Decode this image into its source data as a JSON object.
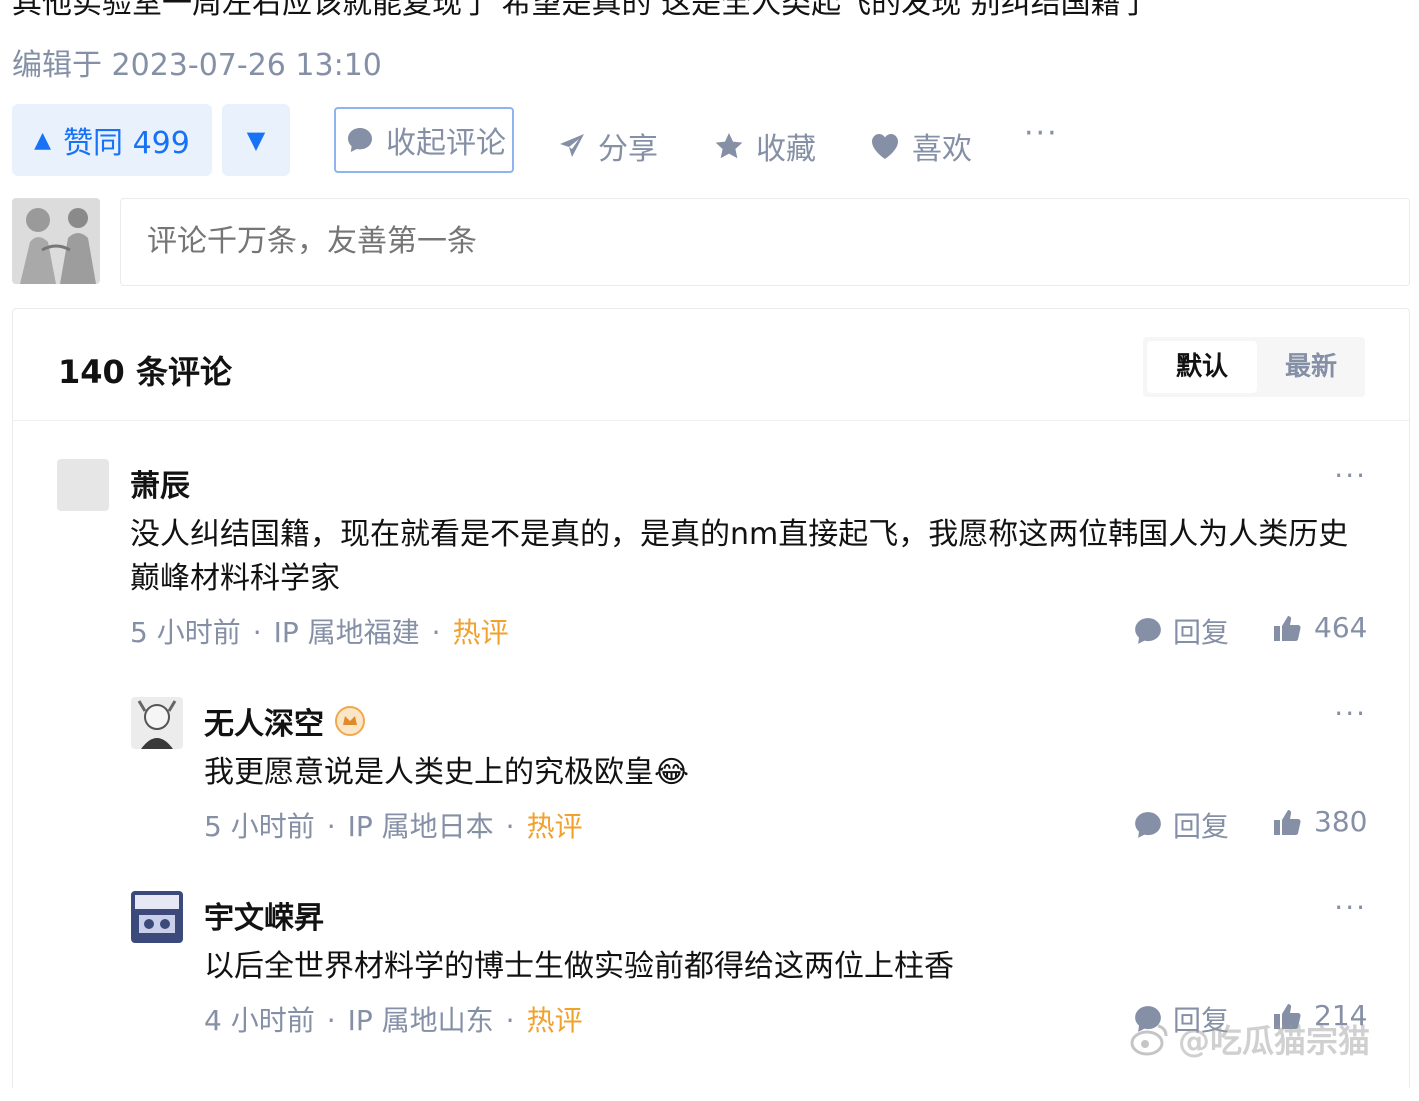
{
  "article": {
    "top_text": "其他实验室一周左右应该就能复现了 希望是真的 这是全人类起飞的发现 别纠结国籍了",
    "edited": "编辑于 2023-07-26 13:10"
  },
  "actions": {
    "upvote": "赞同 499",
    "downvote_icon": "triangle-down-icon",
    "collapse_comments": "收起评论",
    "share": "分享",
    "favorite": "收藏",
    "like": "喜欢",
    "more": "···"
  },
  "composer": {
    "placeholder": "评论千万条，友善第一条"
  },
  "comments": {
    "count_label": "140 条评论",
    "sort": {
      "default": "默认",
      "latest": "最新"
    },
    "items": [
      {
        "author": "萧辰",
        "text": "没人纠结国籍，现在就看是不是真的，是真的nm直接起飞，我愿称这两位韩国人为人类历史巅峰材料科学家",
        "time": "5 小时前",
        "ip": "IP 属地福建",
        "tag": "热评",
        "reply_label": "回复",
        "likes": "464",
        "more": "···"
      },
      {
        "author": "无人深空",
        "text": "我更愿意说是人类史上的究极欧皇😂",
        "time": "5 小时前",
        "ip": "IP 属地日本",
        "tag": "热评",
        "reply_label": "回复",
        "likes": "380",
        "more": "···"
      },
      {
        "author": "宇文嵘昇",
        "text": "以后全世界材料学的博士生做实验前都得给这两位上柱香",
        "time": "4 小时前",
        "ip": "IP 属地山东",
        "tag": "热评",
        "reply_label": "回复",
        "likes": "214",
        "more": "···"
      }
    ]
  },
  "watermark": "@吃瓜猫宗猫",
  "colors": {
    "accent": "#1772f6",
    "accent_bg": "#e9f1fd",
    "muted": "#8590a6",
    "hot": "#f1a22d"
  }
}
